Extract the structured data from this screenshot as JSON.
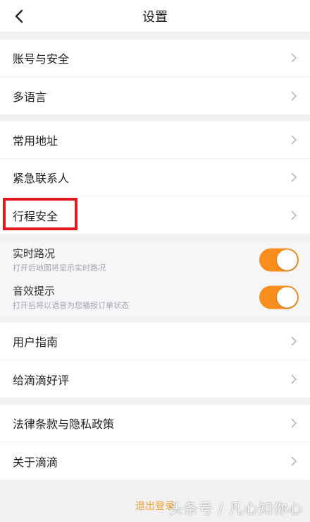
{
  "header": {
    "title": "设置"
  },
  "groups": [
    {
      "items": [
        {
          "label": "账号与安全"
        },
        {
          "label": "多语言"
        }
      ]
    },
    {
      "items": [
        {
          "label": "常用地址"
        },
        {
          "label": "紧急联系人"
        },
        {
          "label": "行程安全"
        }
      ]
    },
    {
      "items": [
        {
          "label": "用户指南"
        },
        {
          "label": "给滴滴好评"
        }
      ]
    },
    {
      "items": [
        {
          "label": "法律条款与隐私政策"
        },
        {
          "label": "关于滴滴"
        }
      ]
    }
  ],
  "toggles": [
    {
      "label": "实时路况",
      "sub": "打开后地图将显示实时路况",
      "on": true
    },
    {
      "label": "音效提示",
      "sub": "打开后将以语音为您播报订单状态",
      "on": true
    }
  ],
  "footer": {
    "logout_label": "退出登录"
  },
  "watermark": "头条号 / 凡心知你心",
  "colors": {
    "accent": "#f78d1d",
    "highlight": "#e3181e"
  }
}
